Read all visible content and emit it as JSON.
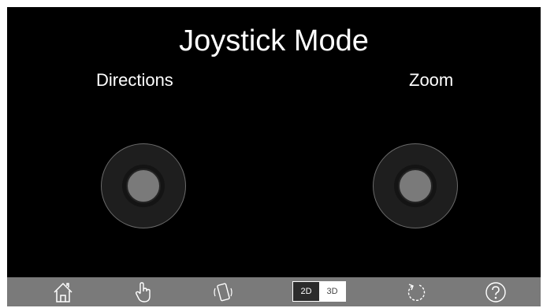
{
  "header": {
    "title": "Joystick Mode"
  },
  "joysticks": {
    "left_label": "Directions",
    "right_label": "Zoom"
  },
  "toolbar": {
    "view_toggle": {
      "option_2d": "2D",
      "option_3d": "3D",
      "selected": "2D"
    },
    "icons": [
      "home-icon",
      "hand-pointer-icon",
      "phone-vibrate-icon",
      "refresh-icon",
      "help-icon"
    ]
  },
  "colors": {
    "background": "#000000",
    "toolbar": "#7a7a7a",
    "knob": "#7a7a7a",
    "text": "#ffffff"
  }
}
